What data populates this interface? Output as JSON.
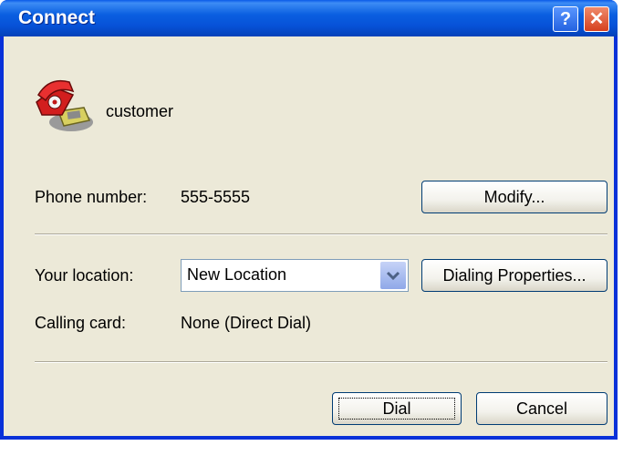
{
  "window": {
    "title": "Connect",
    "help_label": "?",
    "close_label": "✕"
  },
  "connection": {
    "name": "customer",
    "phone_label": "Phone number:",
    "phone_value": "555-5555",
    "modify_label": "Modify..."
  },
  "location": {
    "label": "Your location:",
    "selected": "New Location",
    "dialing_properties_label": "Dialing Properties..."
  },
  "calling_card": {
    "label": "Calling card:",
    "value": "None (Direct Dial)"
  },
  "footer": {
    "dial_label": "Dial",
    "cancel_label": "Cancel"
  },
  "colors": {
    "title_bar": "#0a5fe0",
    "dialog_bg": "#ece9d8",
    "close_red": "#d6401e"
  }
}
